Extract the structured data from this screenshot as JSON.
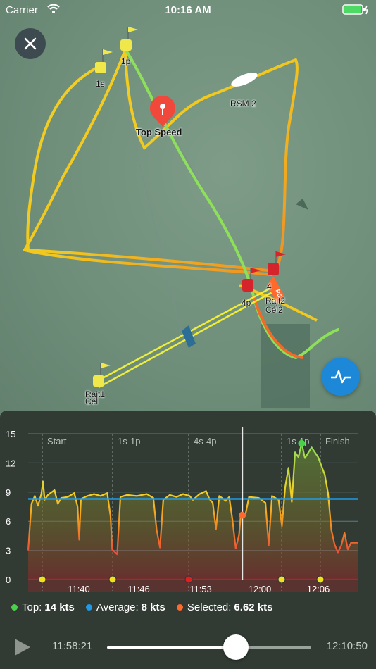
{
  "status_bar": {
    "carrier": "Carrier",
    "time": "10:16 AM"
  },
  "map": {
    "marks": [
      {
        "id": "1s",
        "label": "1s"
      },
      {
        "id": "1p",
        "label": "1p"
      },
      {
        "id": "4p",
        "label": "4p"
      },
      {
        "id": "4",
        "label": "4"
      },
      {
        "id": "rc2",
        "label": "Rajt2\nCél2"
      },
      {
        "id": "rc1",
        "label": "Rajt1\nCél"
      }
    ],
    "rsm_label": "RSM 2",
    "top_speed_label": "Top Speed",
    "rc_flag_text": "RC"
  },
  "chart": {
    "y_ticks": [
      "15",
      "12",
      "9",
      "6",
      "3",
      "0"
    ],
    "x_ticks": [
      "11:40",
      "11:46",
      "11:53",
      "12:00",
      "12:06"
    ],
    "legs": [
      "Start",
      "1s-1p",
      "4s-4p",
      "1s-1p",
      "Finish"
    ],
    "average_kts": 8.3,
    "selected_time_pct": 0.65,
    "selected_kts": 6.62,
    "top_kts": 14,
    "colors": {
      "top": "#4cd04c",
      "average": "#1e9be8",
      "selected": "#ff6a2c"
    }
  },
  "legend": {
    "top_label": "Top:",
    "top_value": "14 kts",
    "average_label": "Average:",
    "average_value": "8 kts",
    "selected_label": "Selected:",
    "selected_value": "6.62 kts"
  },
  "player": {
    "current_time": "11:58:21",
    "end_time": "12:10:50",
    "progress": 0.63
  }
}
